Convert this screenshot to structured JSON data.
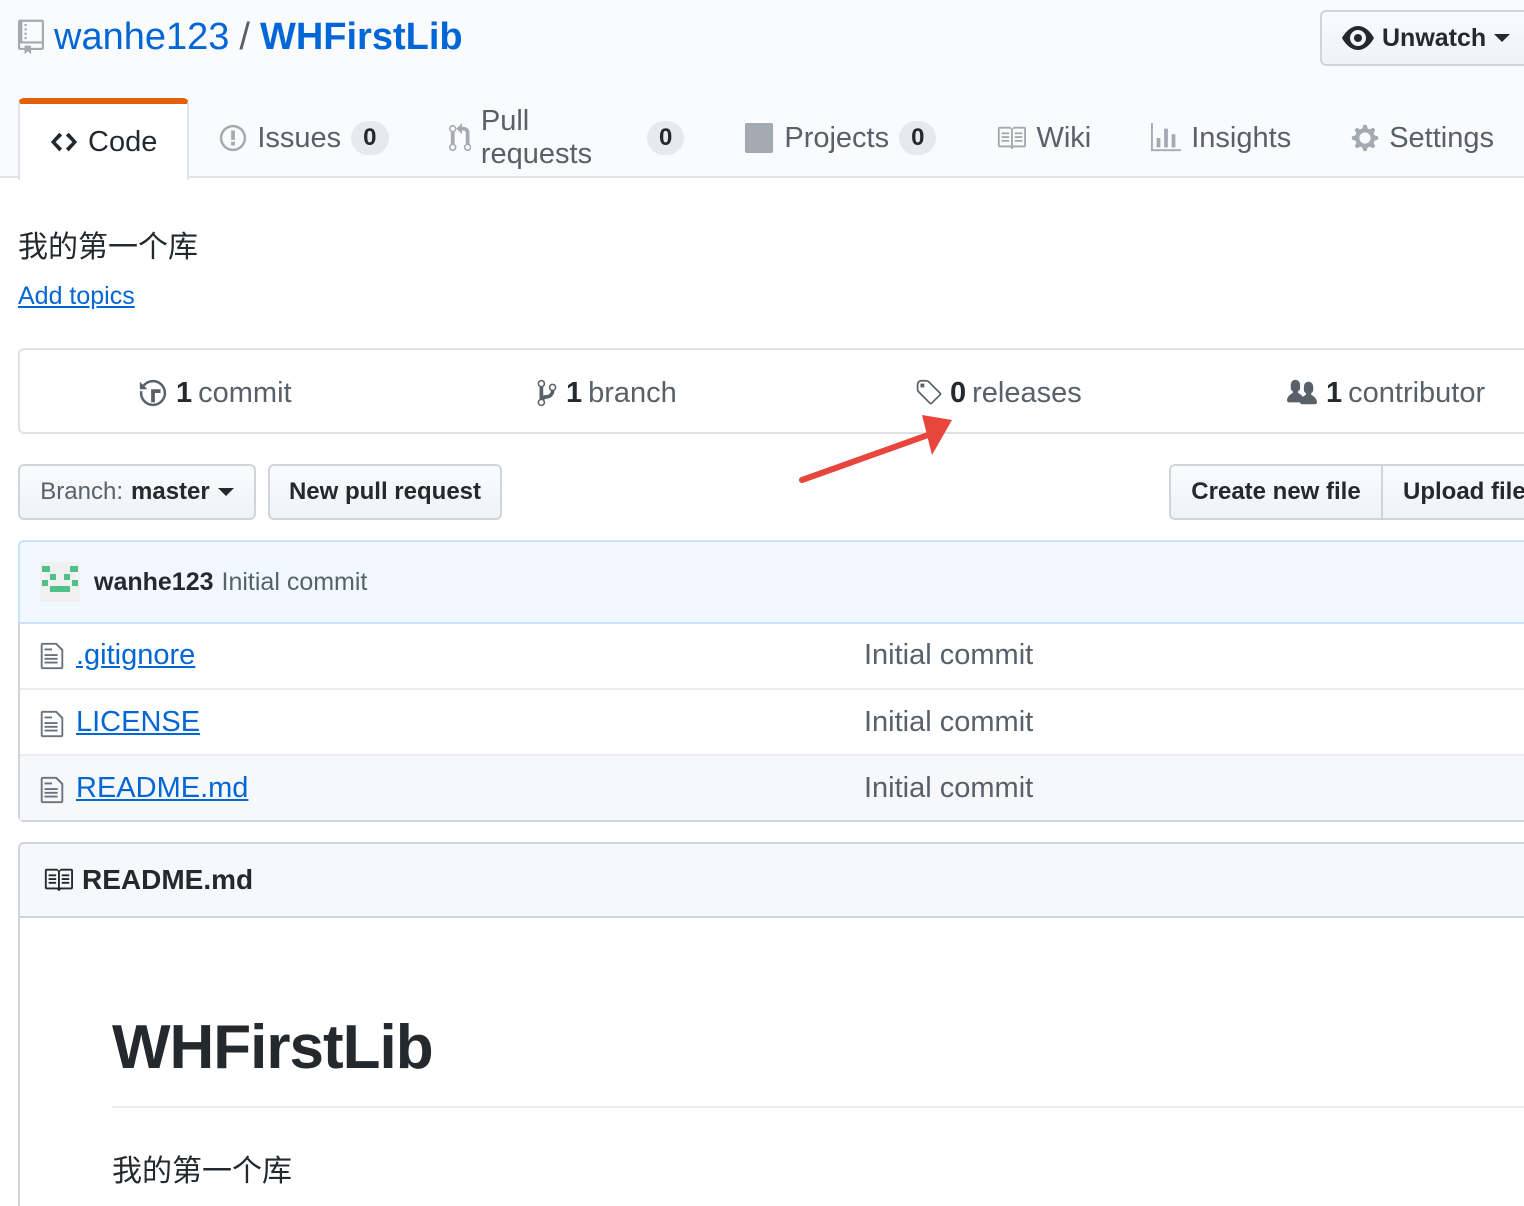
{
  "repo": {
    "owner": "wanhe123",
    "separator": "/",
    "name": "WHFirstLib"
  },
  "watch": {
    "label": "Unwatch"
  },
  "tabs": [
    {
      "label": "Code",
      "icon": "code-icon"
    },
    {
      "label": "Issues",
      "count": "0",
      "icon": "issue-icon"
    },
    {
      "label": "Pull requests",
      "count": "0",
      "icon": "pull-request-icon"
    },
    {
      "label": "Projects",
      "count": "0",
      "icon": "project-icon"
    },
    {
      "label": "Wiki",
      "icon": "book-icon"
    },
    {
      "label": "Insights",
      "icon": "graph-icon"
    },
    {
      "label": "Settings",
      "icon": "gear-icon"
    }
  ],
  "description": "我的第一个库",
  "add_topics": "Add topics",
  "summary": {
    "commits": {
      "num": "1",
      "label": "commit"
    },
    "branches": {
      "num": "1",
      "label": "branch"
    },
    "releases": {
      "num": "0",
      "label": "releases"
    },
    "contributors": {
      "num": "1",
      "label": "contributor"
    }
  },
  "annotation": {
    "arrow_color": "#e8453c"
  },
  "file_nav": {
    "branch_prefix": "Branch:",
    "branch_name": "master",
    "new_pr": "New pull request",
    "create_file": "Create new file",
    "upload_files": "Upload files"
  },
  "commit_tease": {
    "author": "wanhe123",
    "message": "Initial commit"
  },
  "files": [
    {
      "name": ".gitignore",
      "message": "Initial commit"
    },
    {
      "name": "LICENSE",
      "message": "Initial commit"
    },
    {
      "name": "README.md",
      "message": "Initial commit"
    }
  ],
  "readme": {
    "filename": "README.md",
    "heading": "WHFirstLib",
    "paragraph": "我的第一个库"
  },
  "colors": {
    "link": "#0366d6",
    "tab_accent": "#e36209",
    "commit_bg": "#f1f8ff"
  }
}
